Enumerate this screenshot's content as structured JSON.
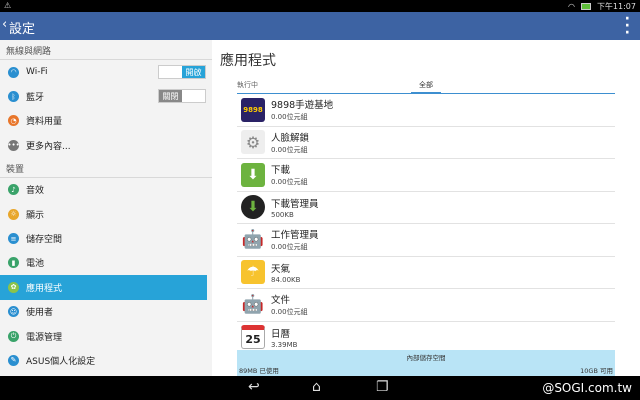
{
  "status": {
    "time": "下午11:07",
    "warning": "⚠"
  },
  "actionbar": {
    "title": "設定"
  },
  "sidebar": {
    "section1": "無線與網路",
    "section2": "裝置",
    "wifi": {
      "label": "Wi-Fi",
      "toggle_on": "開啟"
    },
    "bluetooth": {
      "label": "藍牙",
      "toggle_off": "關閉"
    },
    "data_usage": {
      "label": "資料用量"
    },
    "more": {
      "label": "更多內容..."
    },
    "sound": {
      "label": "音效"
    },
    "display": {
      "label": "顯示"
    },
    "storage": {
      "label": "儲存空間"
    },
    "battery": {
      "label": "電池"
    },
    "apps": {
      "label": "應用程式"
    },
    "users": {
      "label": "使用者"
    },
    "power": {
      "label": "電源管理"
    },
    "asus": {
      "label": "ASUS個人化設定"
    }
  },
  "main": {
    "title": "應用程式",
    "tab_running": "執行中",
    "tab_all": "全部",
    "apps": [
      {
        "name": "9898手遊基地",
        "size": "0.00位元組"
      },
      {
        "name": "人臉解鎖",
        "size": "0.00位元組"
      },
      {
        "name": "下載",
        "size": "0.00位元組"
      },
      {
        "name": "下載管理員",
        "size": "500KB"
      },
      {
        "name": "工作管理員",
        "size": "0.00位元組"
      },
      {
        "name": "天氣",
        "size": "84.00KB"
      },
      {
        "name": "文件",
        "size": "0.00位元組"
      },
      {
        "name": "日曆",
        "size": "3.39MB"
      }
    ],
    "calendar_day": "25",
    "storage": {
      "label": "內部儲存空間",
      "used": "89MB 已使用",
      "free": "10GB 可用",
      "used_fraction": 0.01
    }
  },
  "watermark": "@SOGI.com.tw",
  "colors": {
    "actionbar": "#3d63a3",
    "accent": "#27a3d8"
  }
}
